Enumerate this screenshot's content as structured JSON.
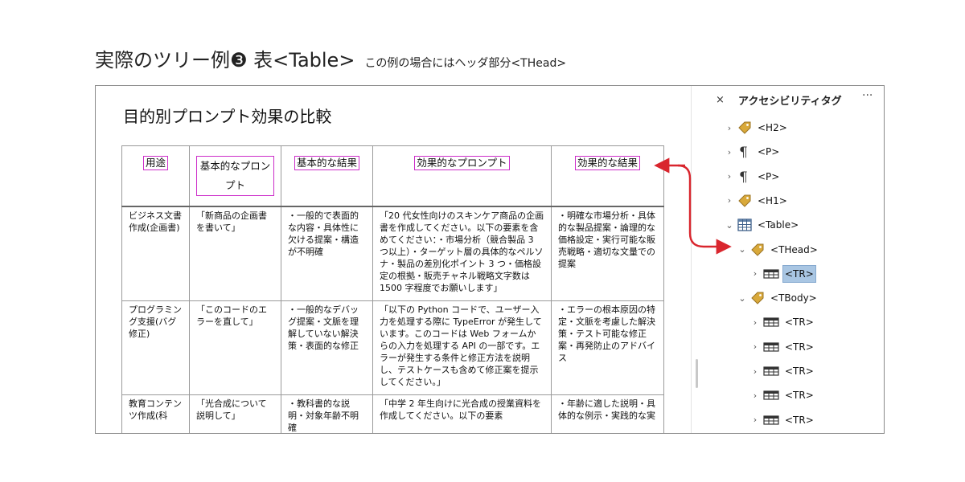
{
  "slide": {
    "title": "実際のツリー例❸ 表<Table>",
    "subtitle": "この例の場合にはヘッダ部分<THead>"
  },
  "document": {
    "heading": "目的別プロンプト効果の比較",
    "table": {
      "headers": [
        "用途",
        "基本的なプロンプト",
        "基本的な結果",
        "効果的なプロンプト",
        "効果的な結果"
      ],
      "rows": [
        [
          "ビジネス文書作成(企画書)",
          "「新商品の企画書を書いて」",
          "・一般的で表面的な内容・具体性に欠ける提案・構造が不明確",
          "「20 代女性向けのスキンケア商品の企画書を作成してください。以下の要素を含めてください：・市場分析（競合製品 3 つ以上）・ターゲット層の具体的なペルソナ・製品の差別化ポイント 3 つ・価格設定の根拠・販売チャネル戦略文字数は 1500 字程度でお願いします」",
          "・明確な市場分析・具体的な製品提案・論理的な価格設定・実行可能な販売戦略・適切な文量での提案"
        ],
        [
          "プログラミング支援(バグ修正)",
          "「このコードのエラーを直して」",
          "・一般的なデバッグ提案・文脈を理解していない解決策・表面的な修正",
          "「以下の Python コードで、ユーザー入力を処理する際に TypeError が発生しています。このコードは Web フォームからの入力を処理する API の一部です。エラーが発生する条件と修正方法を説明し、テストケースも含めて修正案を提示してください。」",
          "・エラーの根本原因の特定・文脈を考慮した解決策・テスト可能な修正案・再発防止のアドバイス"
        ],
        [
          "教育コンテンツ作成(科",
          "「光合成について説明して」",
          "・教科書的な説明・対象年齢不明確",
          "「中学 2 年生向けに光合成の授業資料を作成してください。以下の要素",
          "・年齢に適した説明・具体的な例示・実践的な実"
        ]
      ]
    }
  },
  "panel": {
    "close": "×",
    "title": "アクセシビリティタグ",
    "more": "···",
    "items": [
      {
        "label": "<H2>",
        "icon": "tag-icon",
        "chevron": "›",
        "depth": 1
      },
      {
        "label": "<P>",
        "icon": "pilcrow-icon",
        "chevron": "›",
        "depth": 1
      },
      {
        "label": "<P>",
        "icon": "pilcrow-icon",
        "chevron": "›",
        "depth": 1
      },
      {
        "label": "<H1>",
        "icon": "tag-icon",
        "chevron": "›",
        "depth": 1
      },
      {
        "label": "<Table>",
        "icon": "table-icon",
        "chevron": "⌄",
        "depth": 1
      },
      {
        "label": "<THead>",
        "icon": "tag-icon",
        "chevron": "⌄",
        "depth": 2
      },
      {
        "label": "<TR>",
        "icon": "table-row-icon",
        "chevron": "›",
        "depth": 3,
        "selected": true
      },
      {
        "label": "<TBody>",
        "icon": "tag-icon",
        "chevron": "⌄",
        "depth": 2
      },
      {
        "label": "<TR>",
        "icon": "table-row-icon",
        "chevron": "›",
        "depth": 3
      },
      {
        "label": "<TR>",
        "icon": "table-row-icon",
        "chevron": "›",
        "depth": 3
      },
      {
        "label": "<TR>",
        "icon": "table-row-icon",
        "chevron": "›",
        "depth": 3
      },
      {
        "label": "<TR>",
        "icon": "table-row-icon",
        "chevron": "›",
        "depth": 3
      },
      {
        "label": "<TR>",
        "icon": "table-row-icon",
        "chevron": "›",
        "depth": 3
      }
    ]
  },
  "colors": {
    "highlight_box": "#cc2cc9",
    "arrow": "#d9262e",
    "tag_gold": "#d9a93a",
    "selection": "#a9c6e3"
  }
}
